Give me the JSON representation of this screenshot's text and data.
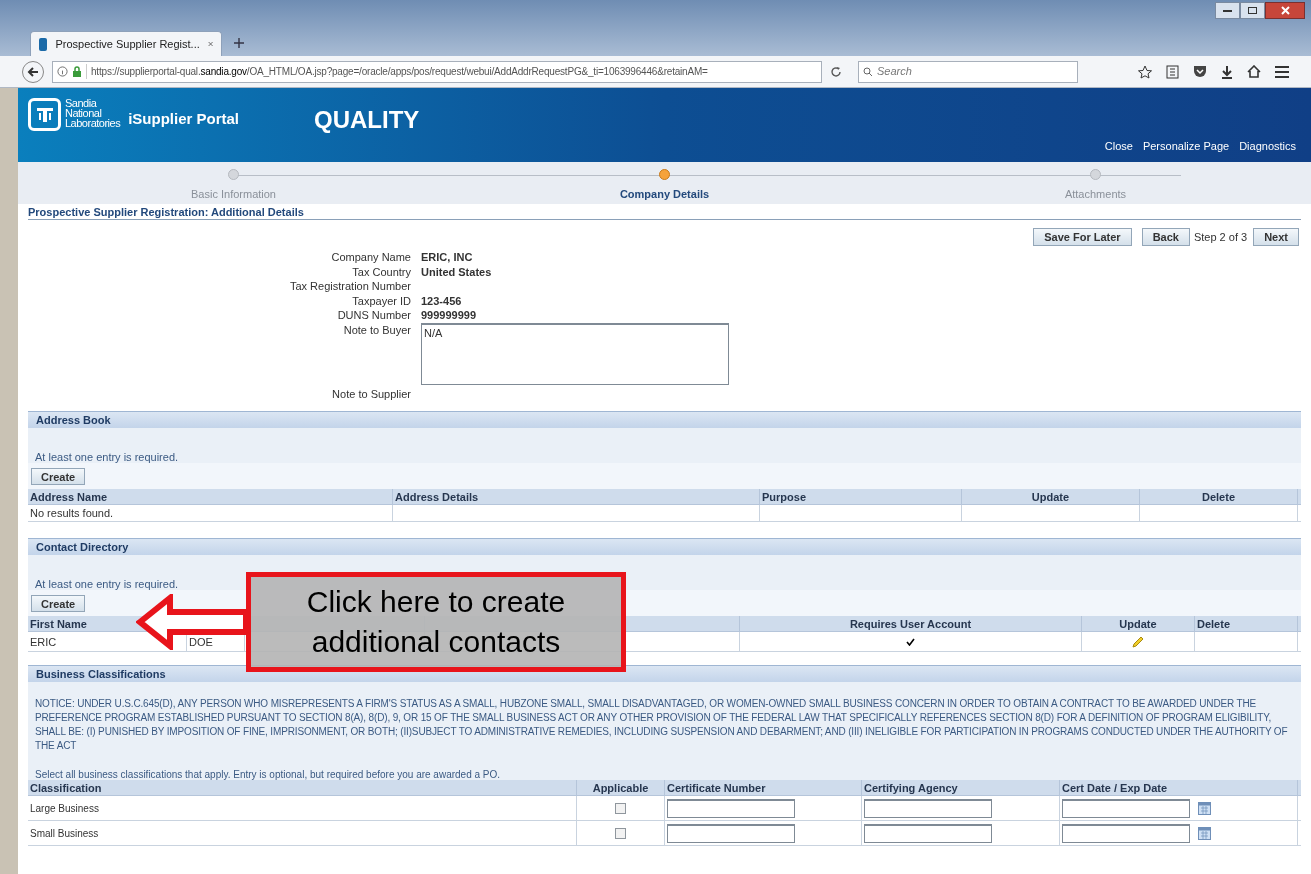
{
  "browser": {
    "tab_title": "Prospective Supplier Regist...",
    "url_start": "https://supplierportal-qual.",
    "url_domain": "sandia.gov",
    "url_rest": "/OA_HTML/OA.jsp?page=/oracle/apps/pos/request/webui/AddAddrRequestPG&_ti=1063996446&retainAM=",
    "search_placeholder": "Search"
  },
  "header": {
    "logo_lines": [
      "Sandia",
      "National",
      "Laboratories"
    ],
    "portal": "iSupplier Portal",
    "title": "QUALITY",
    "links": [
      "Close",
      "Personalize Page",
      "Diagnostics"
    ]
  },
  "train": [
    {
      "label": "Basic Information",
      "selected": false
    },
    {
      "label": "Company Details",
      "selected": true
    },
    {
      "label": "Attachments",
      "selected": false
    }
  ],
  "page_title": "Prospective Supplier Registration: Additional Details",
  "actions": {
    "save": "Save For Later",
    "back": "Back",
    "step": "Step 2 of 3",
    "next": "Next"
  },
  "fields": [
    {
      "label": "Company Name",
      "value": "ERIC, INC",
      "kind": "text"
    },
    {
      "label": "Tax Country",
      "value": "United States",
      "kind": "text"
    },
    {
      "label": "Tax Registration Number",
      "kind": "text"
    },
    {
      "label": "Taxpayer ID",
      "value": "123-456",
      "kind": "text"
    },
    {
      "label": "DUNS Number",
      "value": "999999999",
      "kind": "text"
    },
    {
      "label": "Note to Buyer",
      "value": "N/A",
      "kind": "textarea"
    },
    {
      "label": "Note to Supplier",
      "kind": "text"
    }
  ],
  "address_book": {
    "title": "Address Book",
    "note": "At least one entry is required.",
    "create": "Create",
    "columns": [
      "Address Name",
      "Address Details",
      "Purpose",
      "Update",
      "Delete"
    ],
    "empty": "No results found."
  },
  "contacts": {
    "title": "Contact Directory",
    "note": "At least one entry is required.",
    "create": "Create",
    "columns": [
      {
        "label": "First Name"
      },
      {},
      {},
      {},
      {
        "label": "Requires User Account"
      },
      {
        "label": "Update"
      },
      {
        "label": "Delete"
      }
    ],
    "rows": [
      {
        "first_name": "ERIC",
        "last_name": "DOE",
        "requires_account": true
      }
    ]
  },
  "callout": {
    "text": "Click here to create additional contacts"
  },
  "classifications": {
    "title": "Business Classifications",
    "notice": "NOTICE: UNDER U.S.C.645(D), ANY PERSON WHO MISREPRESENTS A FIRM'S STATUS AS A SMALL, HUBZONE SMALL, SMALL DISADVANTAGED, OR WOMEN-OWNED SMALL BUSINESS CONCERN IN ORDER TO OBTAIN A CONTRACT TO BE AWARDED UNDER THE PREFERENCE PROGRAM ESTABLISHED PURSUANT TO SECTION 8(A), 8(D), 9, OR 15 OF THE SMALL BUSINESS ACT OR ANY OTHER PROVISION OF THE FEDERAL LAW THAT SPECIFICALLY REFERENCES SECTION 8(D) FOR A DEFINITION OF PROGRAM ELIGIBILITY, SHALL BE: (I) PUNISHED BY IMPOSITION OF FINE, IMPRISONMENT, OR BOTH; (II)SUBJECT TO ADMINISTRATIVE REMEDIES, INCLUDING SUSPENSION AND DEBARMENT; AND (III) INELIGIBLE FOR PARTICIPATION IN PROGRAMS CONDUCTED UNDER THE AUTHORITY OF THE ACT",
    "instruction": "Select all business classifications that apply. Entry is optional, but required before you are awarded a PO.",
    "columns": [
      "Classification",
      "Applicable",
      "Certificate Number",
      "Certifying Agency",
      "Cert Date / Exp Date"
    ],
    "rows": [
      {
        "name": "Large Business",
        "applicable": false
      },
      {
        "name": "Small Business",
        "applicable": false
      }
    ]
  }
}
